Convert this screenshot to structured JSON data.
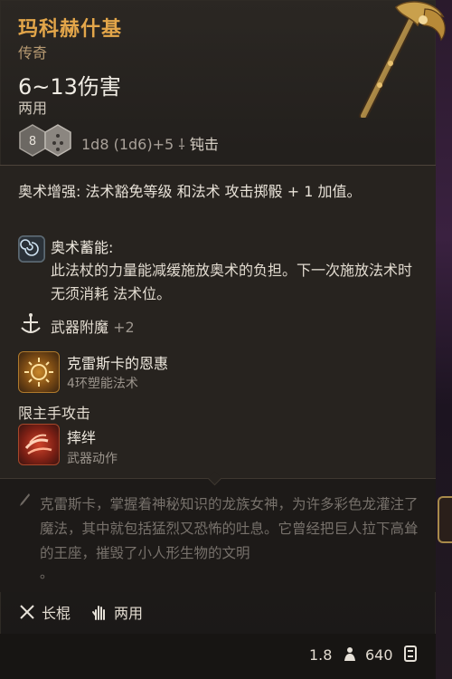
{
  "item": {
    "name": "玛科赫什基",
    "rarity": "传奇",
    "damage": "6~13伤害",
    "handedness": "两用",
    "dice_value": "8",
    "dice_formula": "1d8 (1d6)+5",
    "damage_type": "钝击"
  },
  "enhancement": "奥术增强: 法术豁免等级 和法术 攻击掷骰 + 1 加值。",
  "arcane_charge": {
    "title": "奥术蓄能:",
    "description": "此法杖的力量能减缓施放奥术的负担。下一次施放法术时无须消耗 法术位。"
  },
  "weapon_enchant": {
    "label": "武器附魔",
    "bonus": "+2"
  },
  "spell": {
    "title": "克雷斯卡的恩惠",
    "subtitle": "4环塑能法术"
  },
  "restriction": "限主手攻击",
  "action": {
    "title": "摔绊",
    "subtitle": "武器动作"
  },
  "lore": {
    "line1": "克雷斯卡，掌握着神秘知识的龙族女神，为许多彩色龙灌注了魔法，其中就包括猛烈又恐怖的吐息。它曾经把巨人拉下高耸的王座，摧毁了小人形生物的文明",
    "tail": "。"
  },
  "proficiency": {
    "type": "长棍",
    "hands": "两用"
  },
  "footer": {
    "weight": "1.8",
    "value": "640"
  },
  "colors": {
    "title": "#e3a64a",
    "rarity": "#b79a72",
    "lore": "#77716b"
  }
}
